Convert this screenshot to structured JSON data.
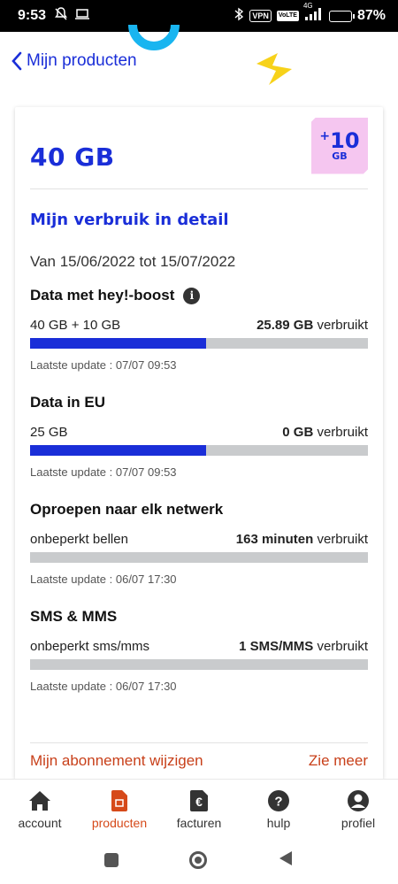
{
  "statusbar": {
    "time": "9:53",
    "vpn": "VPN",
    "volte": "VoLTE",
    "network": "4G",
    "battery": "87%",
    "battery_level": 0.87
  },
  "header": {
    "back_label": "Mijn producten"
  },
  "plan": {
    "title": "40 GB",
    "boost_plus": "+",
    "boost_num": "10",
    "boost_unit": "GB"
  },
  "detail": {
    "title": "Mijn verbruik in detail",
    "period": "Van 15/06/2022 tot 15/07/2022"
  },
  "sections": [
    {
      "title": "Data met hey!-boost",
      "left": "40 GB + 10 GB",
      "used_value": "25.89 GB",
      "used_suffix": "verbruikt",
      "fill": 0.52,
      "update": "Laatste update : 07/07 09:53"
    },
    {
      "title": "Data in EU",
      "left": "25 GB",
      "used_value": "0 GB",
      "used_suffix": "verbruikt",
      "fill": 0.52,
      "update": "Laatste update : 07/07 09:53"
    },
    {
      "title": "Oproepen naar elk netwerk",
      "left": "onbeperkt bellen",
      "used_value": "163 minuten",
      "used_suffix": "verbruikt",
      "fill": 0,
      "update": "Laatste update : 06/07 17:30"
    },
    {
      "title": "SMS & MMS",
      "left": "onbeperkt sms/mms",
      "used_value": "1 SMS/MMS",
      "used_suffix": "verbruikt",
      "fill": 0,
      "update": "Laatste update : 06/07 17:30"
    }
  ],
  "footer": {
    "change_label": "Mijn abonnement wijzigen",
    "more_label": "Zie meer"
  },
  "nav": {
    "items": [
      {
        "label": "account",
        "icon": "home-icon"
      },
      {
        "label": "producten",
        "icon": "phone-icon"
      },
      {
        "label": "facturen",
        "icon": "euro-icon"
      },
      {
        "label": "hulp",
        "icon": "help-icon"
      },
      {
        "label": "profiel",
        "icon": "profile-icon"
      }
    ],
    "active": "producten"
  },
  "colors": {
    "brand_blue": "#1a2ed8",
    "accent_orange": "#d64a1a",
    "badge_pink": "#f5c6f0",
    "bar_grey": "#c9cbcd"
  }
}
